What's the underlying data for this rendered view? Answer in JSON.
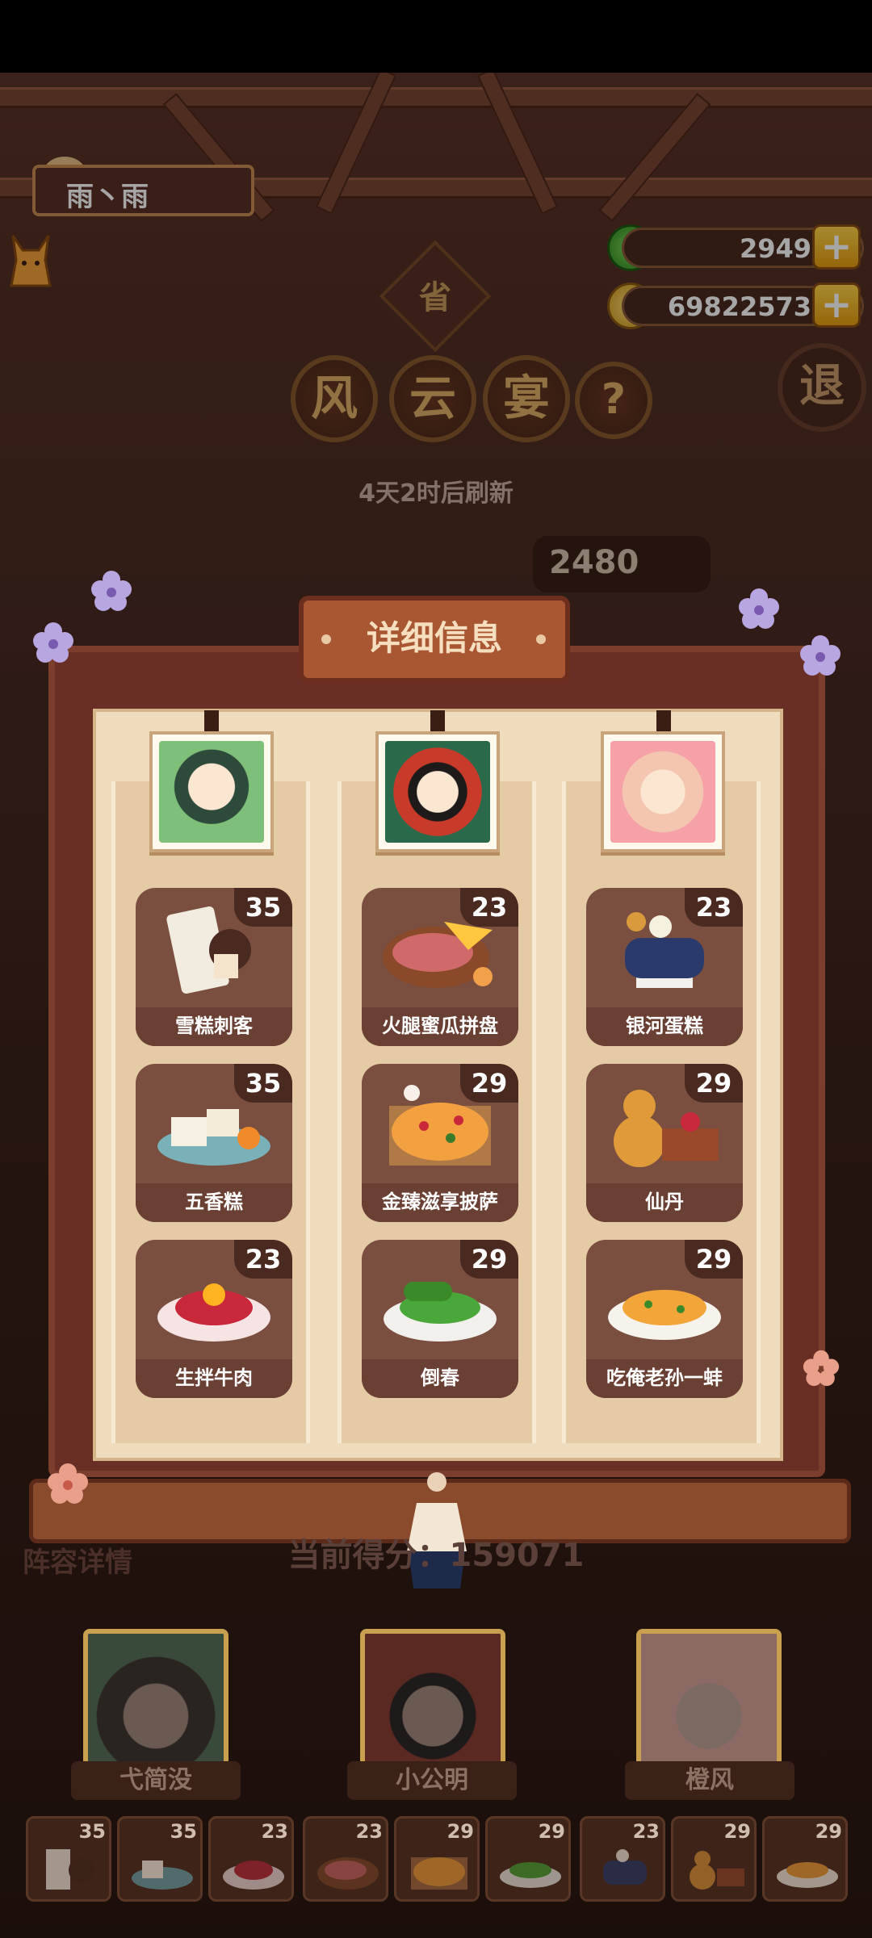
{
  "player": {
    "name": "雨丶雨"
  },
  "currency": {
    "jade": "2949",
    "coins": "69822573"
  },
  "event": {
    "badge": "省",
    "title_chars": [
      "风",
      "云",
      "宴"
    ],
    "help": "?",
    "refresh_text": "4天2时后刷新",
    "back": "退",
    "score_tag": "2480"
  },
  "panel": {
    "title": "详细信息",
    "columns": [
      {
        "character": "character-green-robe",
        "dishes": [
          {
            "name": "雪糕刺客",
            "score": "35"
          },
          {
            "name": "五香糕",
            "score": "35"
          },
          {
            "name": "生拌牛肉",
            "score": "23"
          }
        ]
      },
      {
        "character": "character-opera-mask",
        "dishes": [
          {
            "name": "火腿蜜瓜拼盘",
            "score": "23"
          },
          {
            "name": "金臻滋享披萨",
            "score": "29"
          },
          {
            "name": "倒春",
            "score": "29"
          }
        ]
      },
      {
        "character": "character-pink-hair",
        "dishes": [
          {
            "name": "银河蛋糕",
            "score": "23"
          },
          {
            "name": "仙丹",
            "score": "29"
          },
          {
            "name": "吃俺老孙一蚌",
            "score": "29"
          }
        ]
      }
    ]
  },
  "bottom": {
    "lineup_label": "阵容详情",
    "current_score": "当前得分：159071",
    "heroes": [
      {
        "name": "弋简没"
      },
      {
        "name": "小公明"
      },
      {
        "name": "橙风"
      }
    ],
    "slots": [
      "35",
      "35",
      "23",
      "23",
      "29",
      "29",
      "23",
      "29",
      "29"
    ]
  }
}
